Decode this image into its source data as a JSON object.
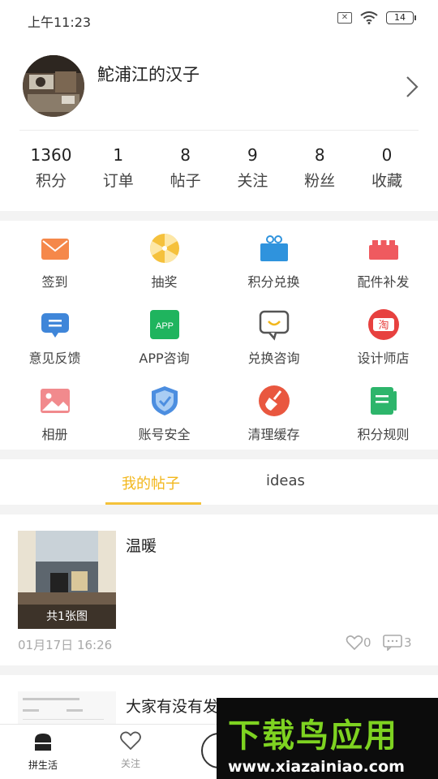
{
  "status_bar": {
    "time": "上午11:23",
    "battery": "14"
  },
  "profile": {
    "username": "鮀浦江的汉子"
  },
  "stats": [
    {
      "value": "1360",
      "label": "积分"
    },
    {
      "value": "1",
      "label": "订单"
    },
    {
      "value": "8",
      "label": "帖子"
    },
    {
      "value": "9",
      "label": "关注"
    },
    {
      "value": "8",
      "label": "粉丝"
    },
    {
      "value": "0",
      "label": "收藏"
    }
  ],
  "grid": [
    {
      "label": "签到",
      "icon": "envelope-icon",
      "color": "#f5884a"
    },
    {
      "label": "抽奖",
      "icon": "lottery-wheel-icon",
      "color": "#f5c13c"
    },
    {
      "label": "积分兑换",
      "icon": "gift-box-icon",
      "color": "#2f93dd"
    },
    {
      "label": "配件补发",
      "icon": "parts-brick-icon",
      "color": "#ef5a5f"
    },
    {
      "label": "意见反馈",
      "icon": "feedback-bubble-icon",
      "color": "#3f86d9"
    },
    {
      "label": "APP咨询",
      "icon": "app-badge-icon",
      "color": "#1fb45e",
      "badge_text": "APP"
    },
    {
      "label": "兑换咨询",
      "icon": "chat-smile-icon",
      "color": "#555555"
    },
    {
      "label": "设计师店",
      "icon": "taobao-icon",
      "color": "#e7413f",
      "badge_text": "淘"
    },
    {
      "label": "相册",
      "icon": "photo-album-icon",
      "color": "#f18a8d"
    },
    {
      "label": "账号安全",
      "icon": "shield-icon",
      "color": "#4c8ee0"
    },
    {
      "label": "清理缓存",
      "icon": "broom-icon",
      "color": "#e9573f"
    },
    {
      "label": "积分规则",
      "icon": "rules-book-icon",
      "color": "#2db56b"
    }
  ],
  "tabs": {
    "posts": "我的帖子",
    "ideas": "ideas"
  },
  "posts": [
    {
      "title": "温暖",
      "thumb_caption": "共1张图",
      "date": "01月17日 16:26",
      "likes": "0",
      "comments": "3"
    },
    {
      "title": "大家有没有发现积分规则变了？"
    }
  ],
  "bottom_nav": {
    "home": "拼生活",
    "follow": "关注"
  },
  "watermark": {
    "title": "下载鸟应用",
    "url": "www.xiazainiao.com"
  },
  "colors": {
    "accent": "#f2b71c",
    "watermark_green": "#7ed321"
  }
}
